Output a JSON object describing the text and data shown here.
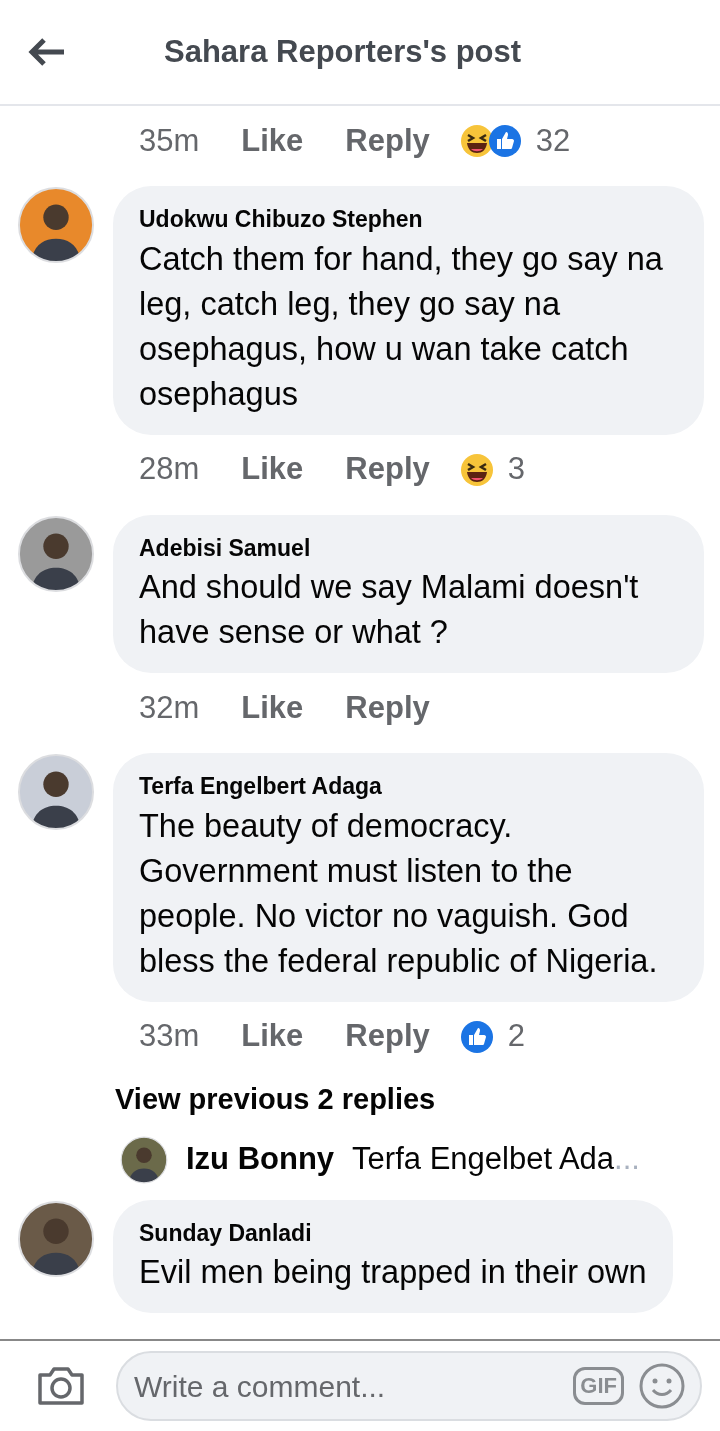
{
  "header": {
    "title": "Sahara Reporters's post"
  },
  "top_meta": {
    "time": "35m",
    "like": "Like",
    "reply": "Reply",
    "reactions": [
      {
        "kind": "haha"
      },
      {
        "kind": "like"
      }
    ],
    "count": "32"
  },
  "comments": [
    {
      "name": "Udokwu Chibuzo Stephen",
      "text": "Catch them for hand, they go say na leg, catch leg, they go say na osephagus, how u wan take catch osephagus",
      "time": "28m",
      "like": "Like",
      "reply": "Reply",
      "reactions": [
        {
          "kind": "haha"
        }
      ],
      "count": "3"
    },
    {
      "name": "Adebisi Samuel",
      "text": "And should we say Malami doesn't have sense or what ?",
      "time": "32m",
      "like": "Like",
      "reply": "Reply"
    },
    {
      "name": "Terfa Engelbert Adaga",
      "text": "The beauty of democracy. Government must listen to the people. No victor no vaguish. God bless the federal republic of Nigeria.",
      "time": "33m",
      "like": "Like",
      "reply": "Reply",
      "reactions": [
        {
          "kind": "like"
        }
      ],
      "count": "2",
      "previous_replies": "View previous 2 replies",
      "reply_preview": {
        "name": "Izu Bonny",
        "text": "Terfa Engelbet Ada",
        "ellipsis": "..."
      }
    },
    {
      "name": "Sunday Danladi",
      "text": "Evil men being trapped in their own"
    }
  ],
  "composer": {
    "placeholder": "Write a comment...",
    "gif": "GIF"
  }
}
